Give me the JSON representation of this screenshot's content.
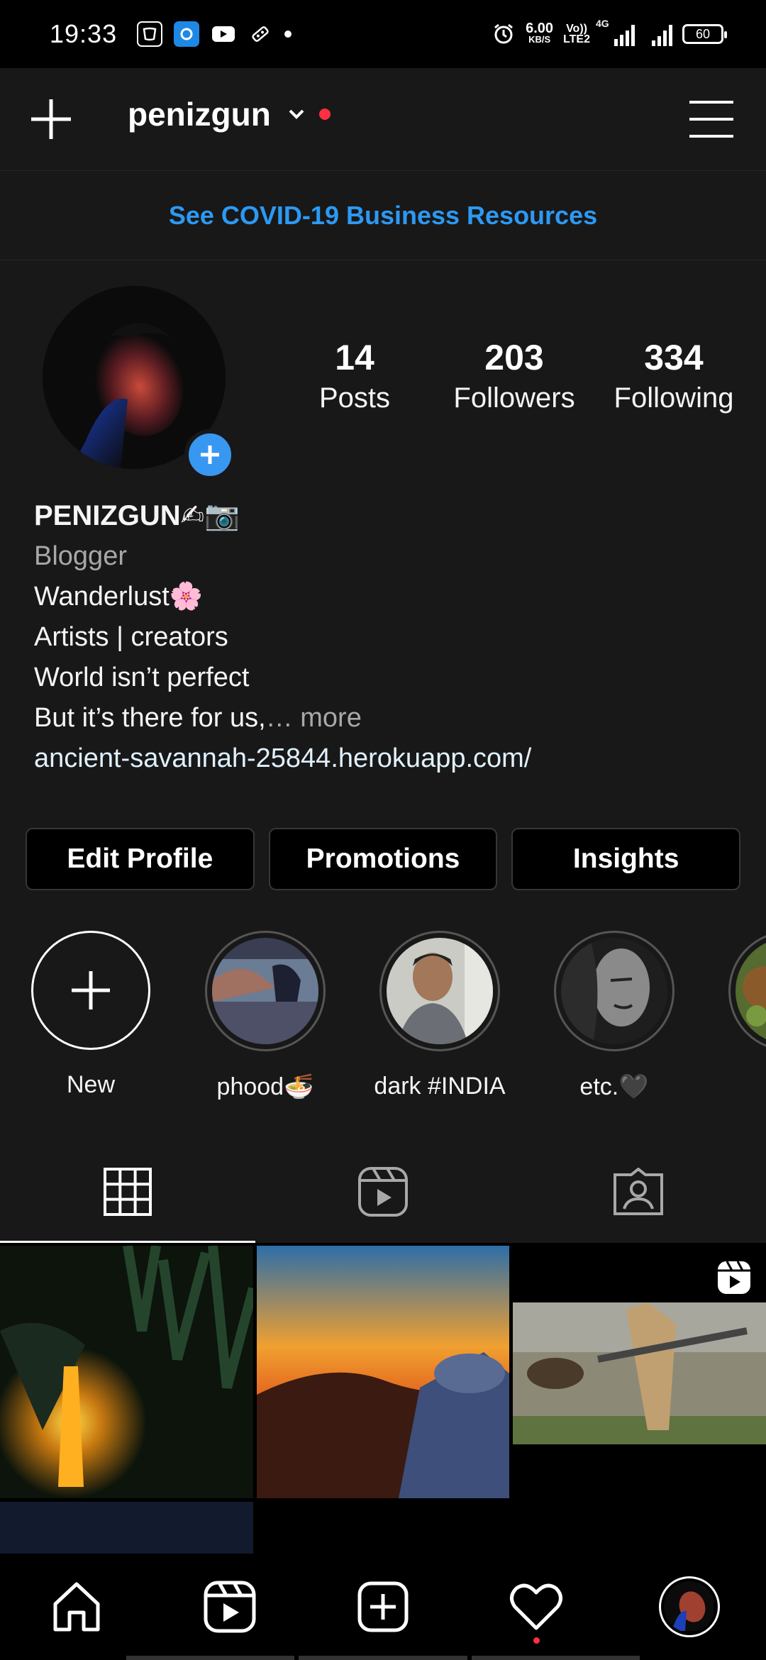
{
  "status_bar": {
    "time": "19:33",
    "net_speed_value": "6.00",
    "net_speed_unit": "KB/S",
    "volte_top": "Vo))",
    "volte_bottom": "LTE2",
    "network_type": "4G",
    "battery": "60"
  },
  "header": {
    "username": "penizgun"
  },
  "banner": {
    "text": "See COVID-19 Business Resources"
  },
  "profile": {
    "stats": [
      {
        "value": "14",
        "label": "Posts"
      },
      {
        "value": "203",
        "label": "Followers"
      },
      {
        "value": "334",
        "label": "Following"
      }
    ],
    "name": "PENIZGUN✍📷",
    "category": "Blogger",
    "bio_lines": [
      "Wanderlust🌸",
      "Artists | creators",
      "World isn’t perfect"
    ],
    "bio_last": "But it’s there for us,",
    "more": "… more",
    "link": "ancient-savannah-25844.herokuapp.com/"
  },
  "actions": {
    "edit_profile": "Edit Profile",
    "promotions": "Promotions",
    "insights": "Insights"
  },
  "highlights": [
    {
      "label": "New"
    },
    {
      "label": "phood🍜"
    },
    {
      "label": "dark #INDIA"
    },
    {
      "label": "etc.🖤"
    }
  ],
  "tabs": [
    "grid-icon",
    "reels-icon",
    "tagged-icon"
  ],
  "colors": {
    "accent": "#3897f0",
    "banner_link": "#2c99f4",
    "notification": "#ff3040",
    "background": "#181818"
  }
}
